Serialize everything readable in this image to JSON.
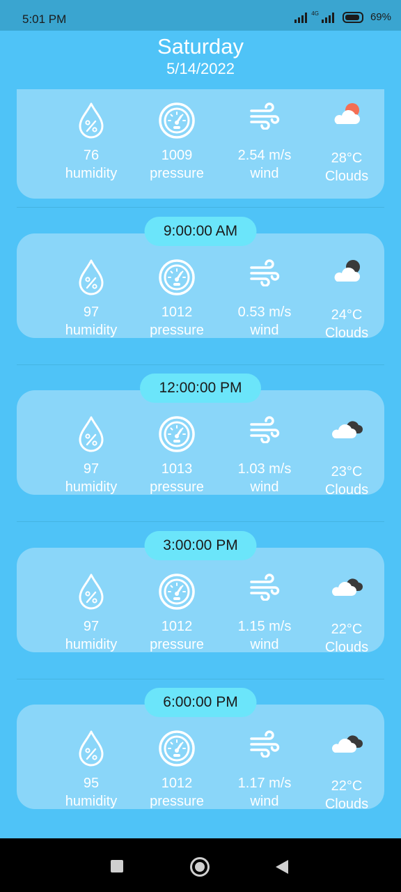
{
  "status_bar": {
    "time": "5:01 PM",
    "battery": "69%"
  },
  "header": {
    "day": "Saturday",
    "date": "5/14/2022"
  },
  "entries": [
    {
      "time": "",
      "humidity": "76",
      "humidity_label": "humidity",
      "pressure": "1009",
      "pressure_label": "pressure",
      "wind": "2.54 m/s",
      "wind_label": "wind",
      "temp": "28°C",
      "weather": "Clouds",
      "icon": "sun-cloud-icon"
    },
    {
      "time": "9:00:00 AM",
      "humidity": "97",
      "humidity_label": "humidity",
      "pressure": "1012",
      "pressure_label": "pressure",
      "wind": "0.53 m/s",
      "wind_label": "wind",
      "temp": "24°C",
      "weather": "Clouds",
      "icon": "moon-cloud-icon"
    },
    {
      "time": "12:00:00 PM",
      "humidity": "97",
      "humidity_label": "humidity",
      "pressure": "1013",
      "pressure_label": "pressure",
      "wind": "1.03 m/s",
      "wind_label": "wind",
      "temp": "23°C",
      "weather": "Clouds",
      "icon": "double-cloud-icon"
    },
    {
      "time": "3:00:00 PM",
      "humidity": "97",
      "humidity_label": "humidity",
      "pressure": "1012",
      "pressure_label": "pressure",
      "wind": "1.15 m/s",
      "wind_label": "wind",
      "temp": "22°C",
      "weather": "Clouds",
      "icon": "double-cloud-icon"
    },
    {
      "time": "6:00:00 PM",
      "humidity": "95",
      "humidity_label": "humidity",
      "pressure": "1012",
      "pressure_label": "pressure",
      "wind": "1.17 m/s",
      "wind_label": "wind",
      "temp": "22°C",
      "weather": "Clouds",
      "icon": "double-cloud-icon"
    }
  ],
  "colors": {
    "background": "#4fc3f7",
    "card": "#8ad6f9",
    "time_pill": "#6be5fa",
    "text": "#ffffff"
  }
}
